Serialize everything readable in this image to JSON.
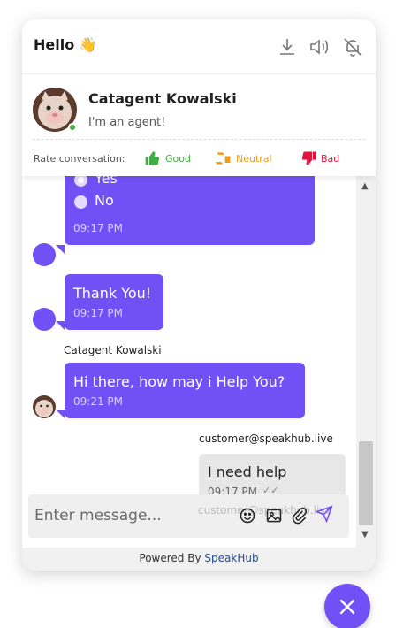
{
  "header": {
    "title": "Hello",
    "wave_emoji": "👋",
    "icons": [
      "download-icon",
      "volume-icon",
      "notifications-off-icon"
    ]
  },
  "agent": {
    "name": "Catagent Kowalski",
    "status_text": "I'm an agent!",
    "online": true,
    "rating": {
      "label": "Rate conversation:",
      "good": "Good",
      "neutral": "Neutral",
      "bad": "Bad"
    }
  },
  "messages": {
    "poll": {
      "options": [
        "Yes",
        "No"
      ],
      "time": "09:17 PM"
    },
    "thank_you": {
      "text": "Thank You!",
      "time": "09:17 PM"
    },
    "agent_greeting": {
      "sender": "Catagent Kowalski",
      "text": "Hi there, how may i Help You?",
      "time": "09:21 PM"
    },
    "customer_msg": {
      "sender": "customer@speakhub.live",
      "text": "I need help",
      "time": "09:17 PM",
      "read_icon": "double-check-icon"
    },
    "faded_sender": "customer@speakhub.live"
  },
  "composer": {
    "placeholder": "Enter message...",
    "icons": [
      "emoji-icon",
      "image-icon",
      "attachment-icon",
      "send-icon"
    ]
  },
  "footer": {
    "powered_by": "Powered By",
    "brand": "SpeakHub"
  },
  "colors": {
    "accent": "#7150f5",
    "good": "#3cb043",
    "neutral": "#f39c12",
    "bad": "#e0143c",
    "brand_link": "#2a4a8a"
  },
  "fab": {
    "icon": "close-icon"
  }
}
